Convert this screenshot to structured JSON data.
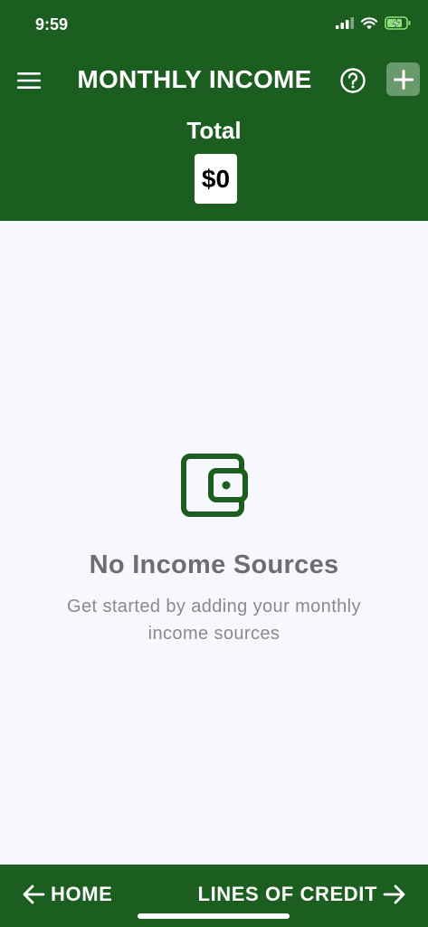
{
  "status_bar": {
    "time": "9:59",
    "signal_icon": "cellular-signal-icon",
    "wifi_icon": "wifi-icon",
    "battery_icon": "battery-charging-icon"
  },
  "header": {
    "title": "MONTHLY INCOME",
    "menu_icon": "hamburger-menu-icon",
    "help_icon": "help-circle-icon",
    "add_icon": "plus-icon",
    "total_label": "Total",
    "total_value": "$0"
  },
  "empty_state": {
    "icon": "wallet-icon",
    "title": "No Income Sources",
    "subtitle": "Get started by adding your monthly income sources"
  },
  "bottom_nav": {
    "back_label": "HOME",
    "back_icon": "arrow-left-icon",
    "forward_label": "LINES OF CREDIT",
    "forward_icon": "arrow-right-icon"
  },
  "colors": {
    "primary_green": "#1c5e20",
    "add_button_bg": "#6a9a6c",
    "background": "#f7f8fd",
    "empty_title": "#6d6d72",
    "empty_subtitle": "#8a8a8e"
  }
}
